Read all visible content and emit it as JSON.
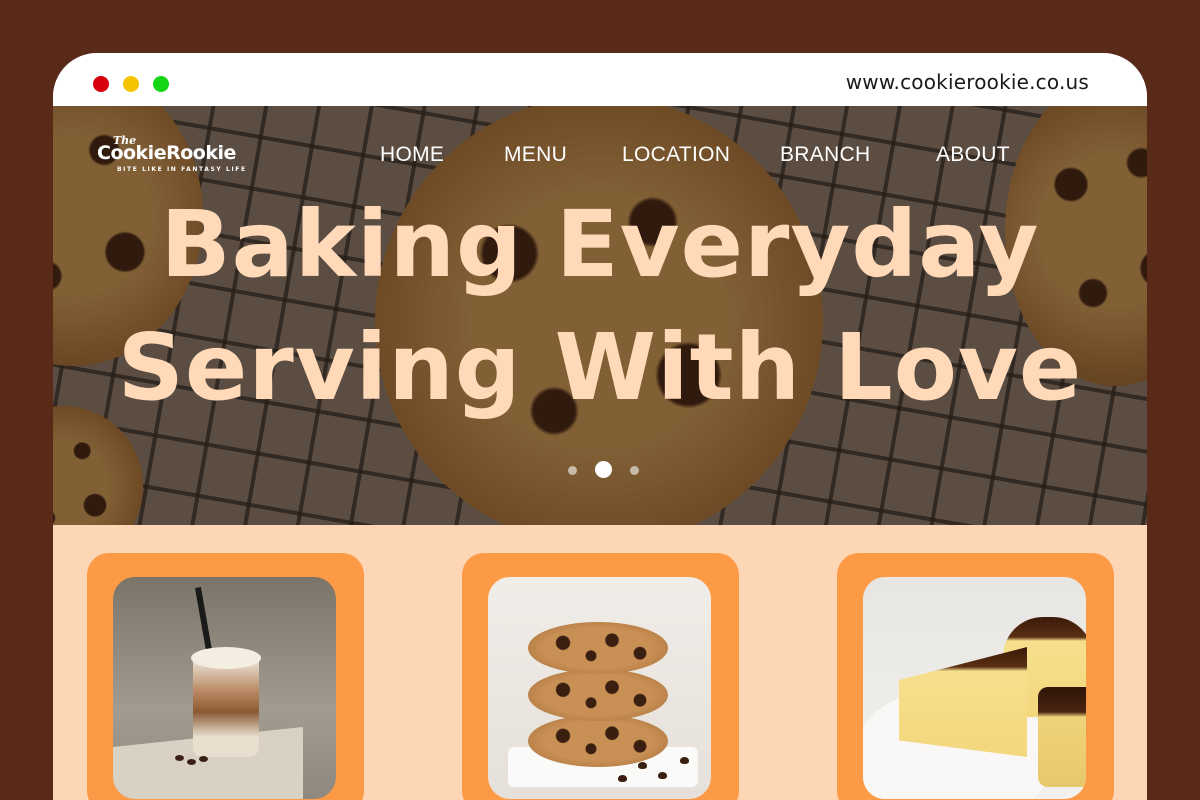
{
  "browser": {
    "url": "www.cookierookie.co.us",
    "controls": [
      "close",
      "minimize",
      "maximize"
    ]
  },
  "brand": {
    "the": "The",
    "name": "CookieRookie",
    "tagline": "BITE LIKE IN FANTASY LIFE"
  },
  "nav": {
    "items": [
      "HOME",
      "MENU",
      "LOCATION",
      "BRANCH",
      "ABOUT"
    ]
  },
  "hero": {
    "line1": "Baking Everyday",
    "line2": "Serving With Love",
    "carousel": {
      "total": 3,
      "active": 2
    }
  },
  "products": [
    {
      "name": "iced-coffee",
      "photo": "iced latte"
    },
    {
      "name": "chocolate-chip-cookies",
      "photo": "stacked cookies"
    },
    {
      "name": "basque-cheesecake",
      "photo": "cheesecake slices"
    }
  ],
  "colors": {
    "frame_bg": "#5a2a18",
    "headline": "#ffd9b8",
    "lower_bg": "#fdd6b5",
    "card": "#fd9a45",
    "dot_red": "#d8000c",
    "dot_yellow": "#f4c400",
    "dot_green": "#14d614"
  }
}
